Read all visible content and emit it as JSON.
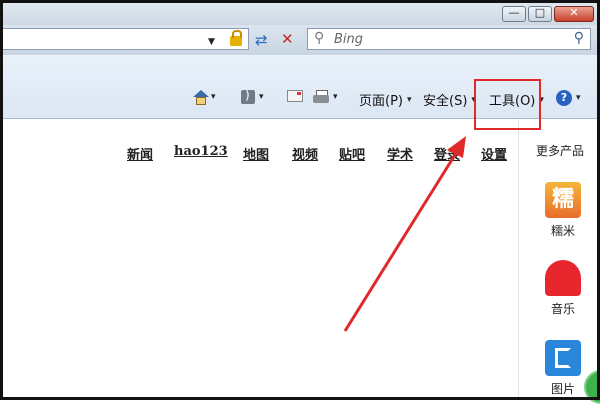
{
  "window": {
    "minimize_glyph": "—",
    "maximize_glyph": "□",
    "close_glyph": "✕"
  },
  "address_bar": {
    "dropdown_glyph": "▼"
  },
  "search": {
    "placeholder": "Bing",
    "lens_glyph": "⚲",
    "go_glyph": "⚲"
  },
  "command_bar": {
    "arrow": "▾",
    "items": [
      {
        "icon": "home-icon"
      },
      {
        "icon": "feeds-icon"
      },
      {
        "icon": "mail-icon"
      },
      {
        "icon": "print-icon"
      },
      {
        "label": "页面(P)"
      },
      {
        "label": "安全(S)"
      },
      {
        "label": "工具(O)"
      },
      {
        "icon": "help-icon",
        "glyph": "?"
      }
    ]
  },
  "page": {
    "nav_links": [
      "新闻",
      "hao123",
      "地图",
      "视频",
      "贴吧",
      "学术",
      "登录",
      "设置"
    ],
    "side_panel": {
      "title": "更多产品",
      "apps": [
        {
          "label": "糯米",
          "glyph": "糯"
        },
        {
          "label": "音乐"
        },
        {
          "label": "图片"
        }
      ]
    }
  },
  "colors": {
    "highlight": "#e02a2a",
    "annotation_arrow": "#e02a2a"
  }
}
